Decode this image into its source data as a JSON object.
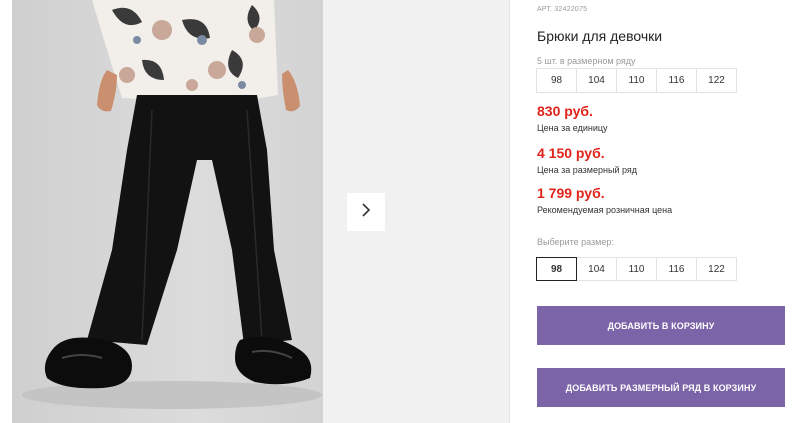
{
  "product": {
    "sku": "АРТ. 32422075",
    "title": "Брюки для девочки"
  },
  "pack": {
    "note": "5 шт. в размерном ряду",
    "sizes": [
      "98",
      "104",
      "110",
      "116",
      "122"
    ]
  },
  "prices": [
    {
      "amount": "830 руб.",
      "label": "Цена за единицу"
    },
    {
      "amount": "4 150 руб.",
      "label": "Цена за размерный ряд"
    },
    {
      "amount": "1 799 руб.",
      "label": "Рекомендуемая розничная цена"
    }
  ],
  "size_select": {
    "label": "Выберите размер:",
    "sizes": [
      "98",
      "104",
      "110",
      "116",
      "122"
    ],
    "selected": "98"
  },
  "buttons": {
    "add_to_cart": "ДОБАВИТЬ В КОРЗИНУ",
    "add_pack_to_cart": "ДОБАВИТЬ РАЗМЕРНЫЙ РЯД В КОРЗИНУ"
  },
  "gallery": {
    "next_icon": "chevron-right-icon"
  },
  "colors": {
    "price": "#e2231a",
    "button": "#7b64a8"
  }
}
